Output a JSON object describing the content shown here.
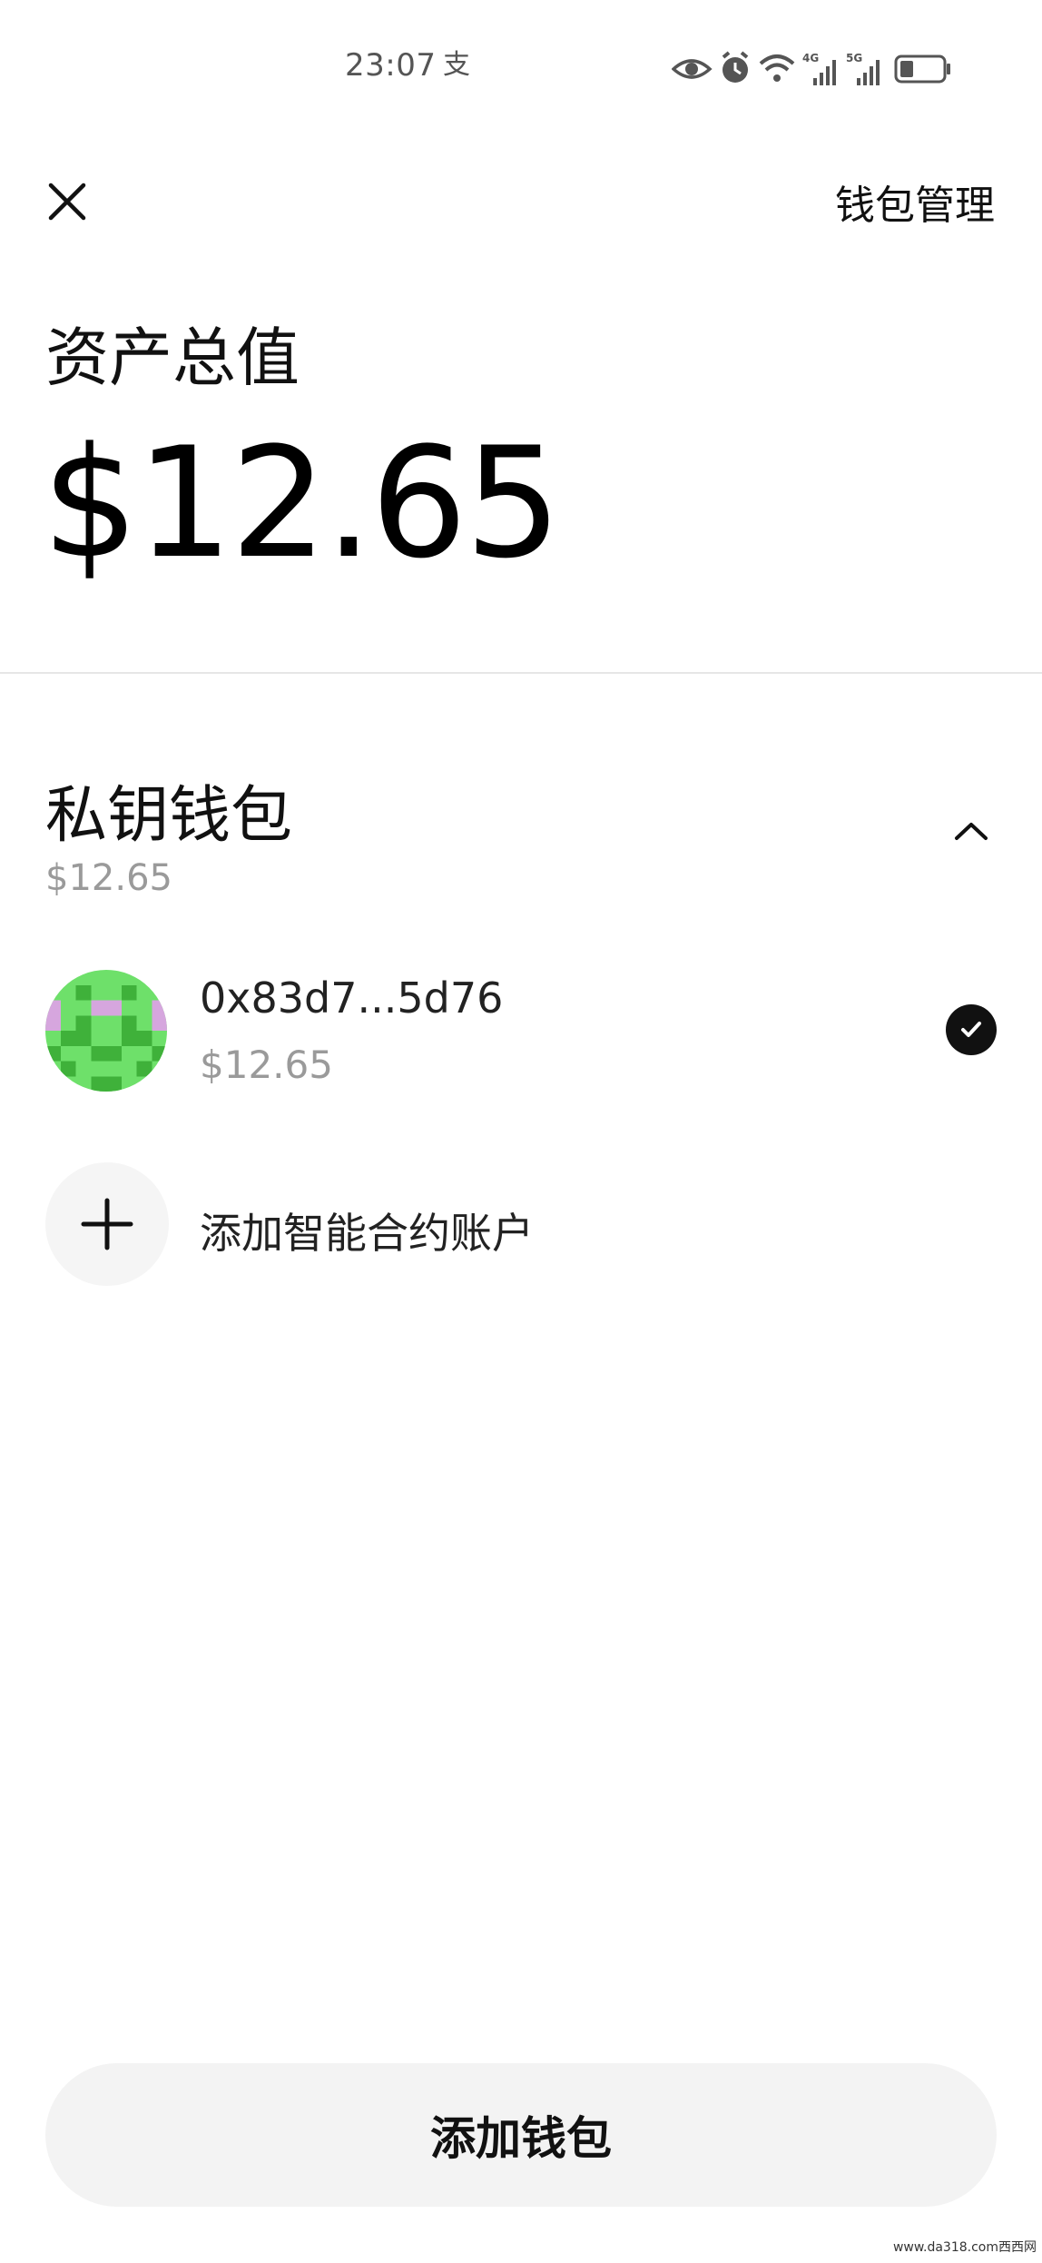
{
  "status_bar": {
    "time": "23:07",
    "alipay_glyph": "支",
    "icons": [
      "eye-icon",
      "alarm-icon",
      "wifi-icon",
      "signal-4g-icon",
      "signal-5g-icon",
      "battery-icon"
    ],
    "network_labels": [
      "4G",
      "5G"
    ]
  },
  "header": {
    "close_icon": "close-icon",
    "manage_label": "钱包管理"
  },
  "assets": {
    "label": "资产总值",
    "value": "$12.65"
  },
  "wallet_group": {
    "title": "私钥钱包",
    "value": "$12.65",
    "collapse_icon": "chevron-up-icon",
    "accounts": [
      {
        "address": "0x83d7...5d76",
        "value": "$12.65",
        "selected": true
      }
    ],
    "add_contract_label": "添加智能合约账户"
  },
  "footer": {
    "add_wallet_label": "添加钱包"
  },
  "watermark": "www.da318.com西西网",
  "colors": {
    "text_primary": "#111111",
    "text_secondary": "#9a9a9a",
    "button_bg": "#f3f3f3",
    "avatar_green": "#6ee06a",
    "avatar_dark_green": "#3fb13a",
    "avatar_pink": "#d6a6de"
  }
}
